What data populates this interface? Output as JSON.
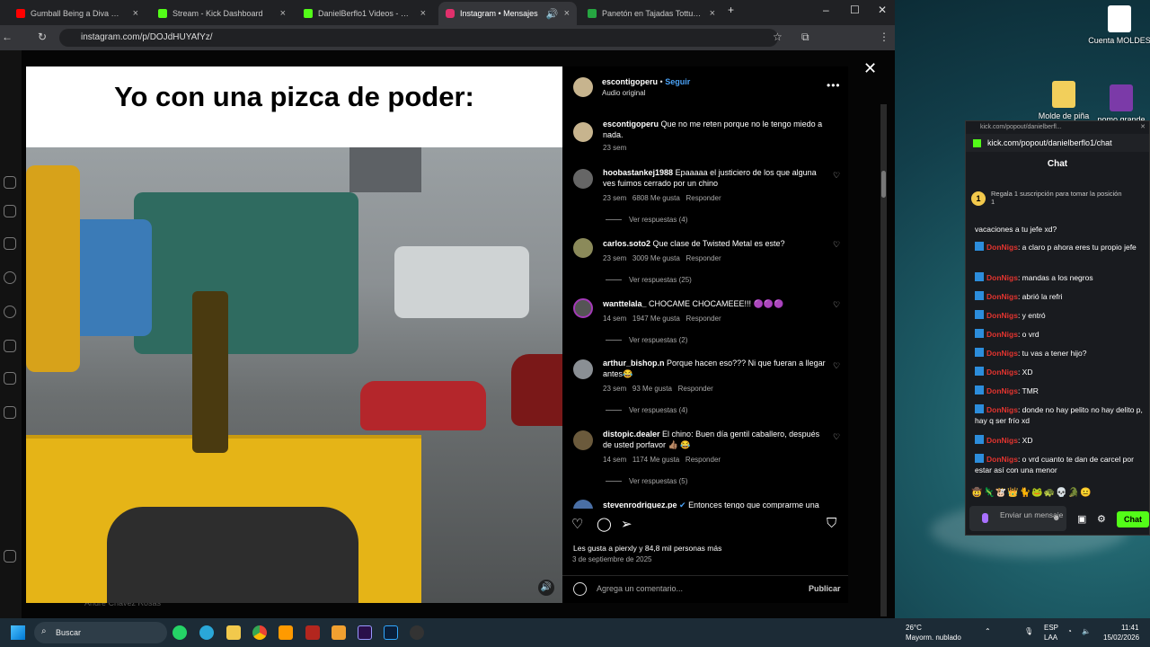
{
  "browser": {
    "tabs": [
      {
        "title": "Gumball Being a Diva 💅 🎀 (Gu",
        "color": "#ff0000"
      },
      {
        "title": "Stream - Kick Dashboard",
        "color": "#53fc18"
      },
      {
        "title": "DanielBerflo1 Videos - Watch C",
        "color": "#53fc18"
      },
      {
        "title": "Instagram • Mensajes",
        "color": "#e1306c"
      },
      {
        "title": "Panetón en Tajadas Tottus Bolsa",
        "color": "#26a641"
      }
    ],
    "url": "instagram.com/p/DOJdHUYAfYz/"
  },
  "post": {
    "caption_text": "Yo con una pizca de poder:",
    "author": "escontigoperu",
    "follow_label": "Seguir",
    "audio": "Audio original",
    "author_comment": {
      "user": "escontigoperu",
      "text": "Que no me reten porque no le tengo miedo a nada.",
      "time": "23 sem"
    },
    "comments": [
      {
        "user": "hoobastankej1988",
        "text": "Epaaaaa el justiciero de los que alguna ves fuimos cerrado por un chino",
        "time": "23 sem",
        "likes": "6808 Me gusta",
        "reply": "Responder",
        "replies": "Ver respuestas (4)"
      },
      {
        "user": "carlos.soto2",
        "text": "Que clase de Twisted Metal es este?",
        "time": "23 sem",
        "likes": "3009 Me gusta",
        "reply": "Responder",
        "replies": "Ver respuestas (25)"
      },
      {
        "user": "wanttelala_",
        "text": "CHOCAME CHOCAMEEE!!! 🟣🟣🟣",
        "time": "14 sem",
        "likes": "1947 Me gusta",
        "reply": "Responder",
        "replies": "Ver respuestas (2)"
      },
      {
        "user": "arthur_bishop.n",
        "text": "Porque hacen eso??? Ni que fueran a llegar antes😂",
        "time": "23 sem",
        "likes": "93 Me gusta",
        "reply": "Responder",
        "replies": "Ver respuestas (4)"
      },
      {
        "user": "distopic.dealer",
        "text": "El chino: Buen día gentil caballero, después de usted porfavor 👍🏽 😂",
        "time": "14 sem",
        "likes": "1174 Me gusta",
        "reply": "Responder",
        "replies": "Ver respuestas (5)"
      },
      {
        "user": "stevenrodriguez.pe",
        "text": "Entonces tengo que comprarme una",
        "time": "",
        "likes": "",
        "reply": "",
        "replies": ""
      }
    ],
    "likes_text": "Les gusta a pierxly y 84,8 mil personas más",
    "date": "3 de septiembre de 2025",
    "comment_placeholder": "Agrega un comentario...",
    "publish_label": "Publicar"
  },
  "desktop": {
    "icons": [
      {
        "label": "Cuenta MOLDES"
      },
      {
        "label": "Molde de piña"
      },
      {
        "label": "pomo grande"
      }
    ]
  },
  "kick": {
    "titlebar": "kick.com/popout/danielberfl...",
    "url": "kick.com/popout/danielberflo1/chat",
    "chat_title": "Chat",
    "promo_rank": "1",
    "promo": "Regala 1 suscripción para tomar la posición 1",
    "first_line": "vacaciones a tu jefe xd?",
    "messages": [
      {
        "nick": "DonNigs",
        "text": ": a claro p ahora eres tu propio jefe"
      },
      {
        "nick": "DonNigs",
        "text": ": mandas a los negros"
      },
      {
        "nick": "DonNigs",
        "text": ": abrió la refri"
      },
      {
        "nick": "DonNigs",
        "text": ": y entró"
      },
      {
        "nick": "DonNigs",
        "text": ": o vrd"
      },
      {
        "nick": "DonNigs",
        "text": ": tu vas a tener hijo?"
      },
      {
        "nick": "DonNigs",
        "text": ": XD"
      },
      {
        "nick": "DonNigs",
        "text": ": TMR"
      },
      {
        "nick": "DonNigs",
        "text": ": donde no hay pelito no hay delito p, hay q ser frío xd"
      },
      {
        "nick": "DonNigs",
        "text": ": XD"
      },
      {
        "nick": "DonNigs",
        "text": ": o vrd cuanto te dan de carcel por estar así con una menor"
      }
    ],
    "emotes": "🤠🦎🐮👑🐈🐸🐢💀🐊😐",
    "send_placeholder": "Enviar un mensaje",
    "chat_button": "Chat"
  },
  "taskbar": {
    "search": "Buscar",
    "weather_temp": "26°C",
    "weather_desc": "Mayorm. nublado",
    "lang": "ESP",
    "lang2": "LAA",
    "time": "11:41",
    "date": "15/02/2026"
  },
  "background": {
    "faded_name": "Andre Chavez Rosas"
  }
}
